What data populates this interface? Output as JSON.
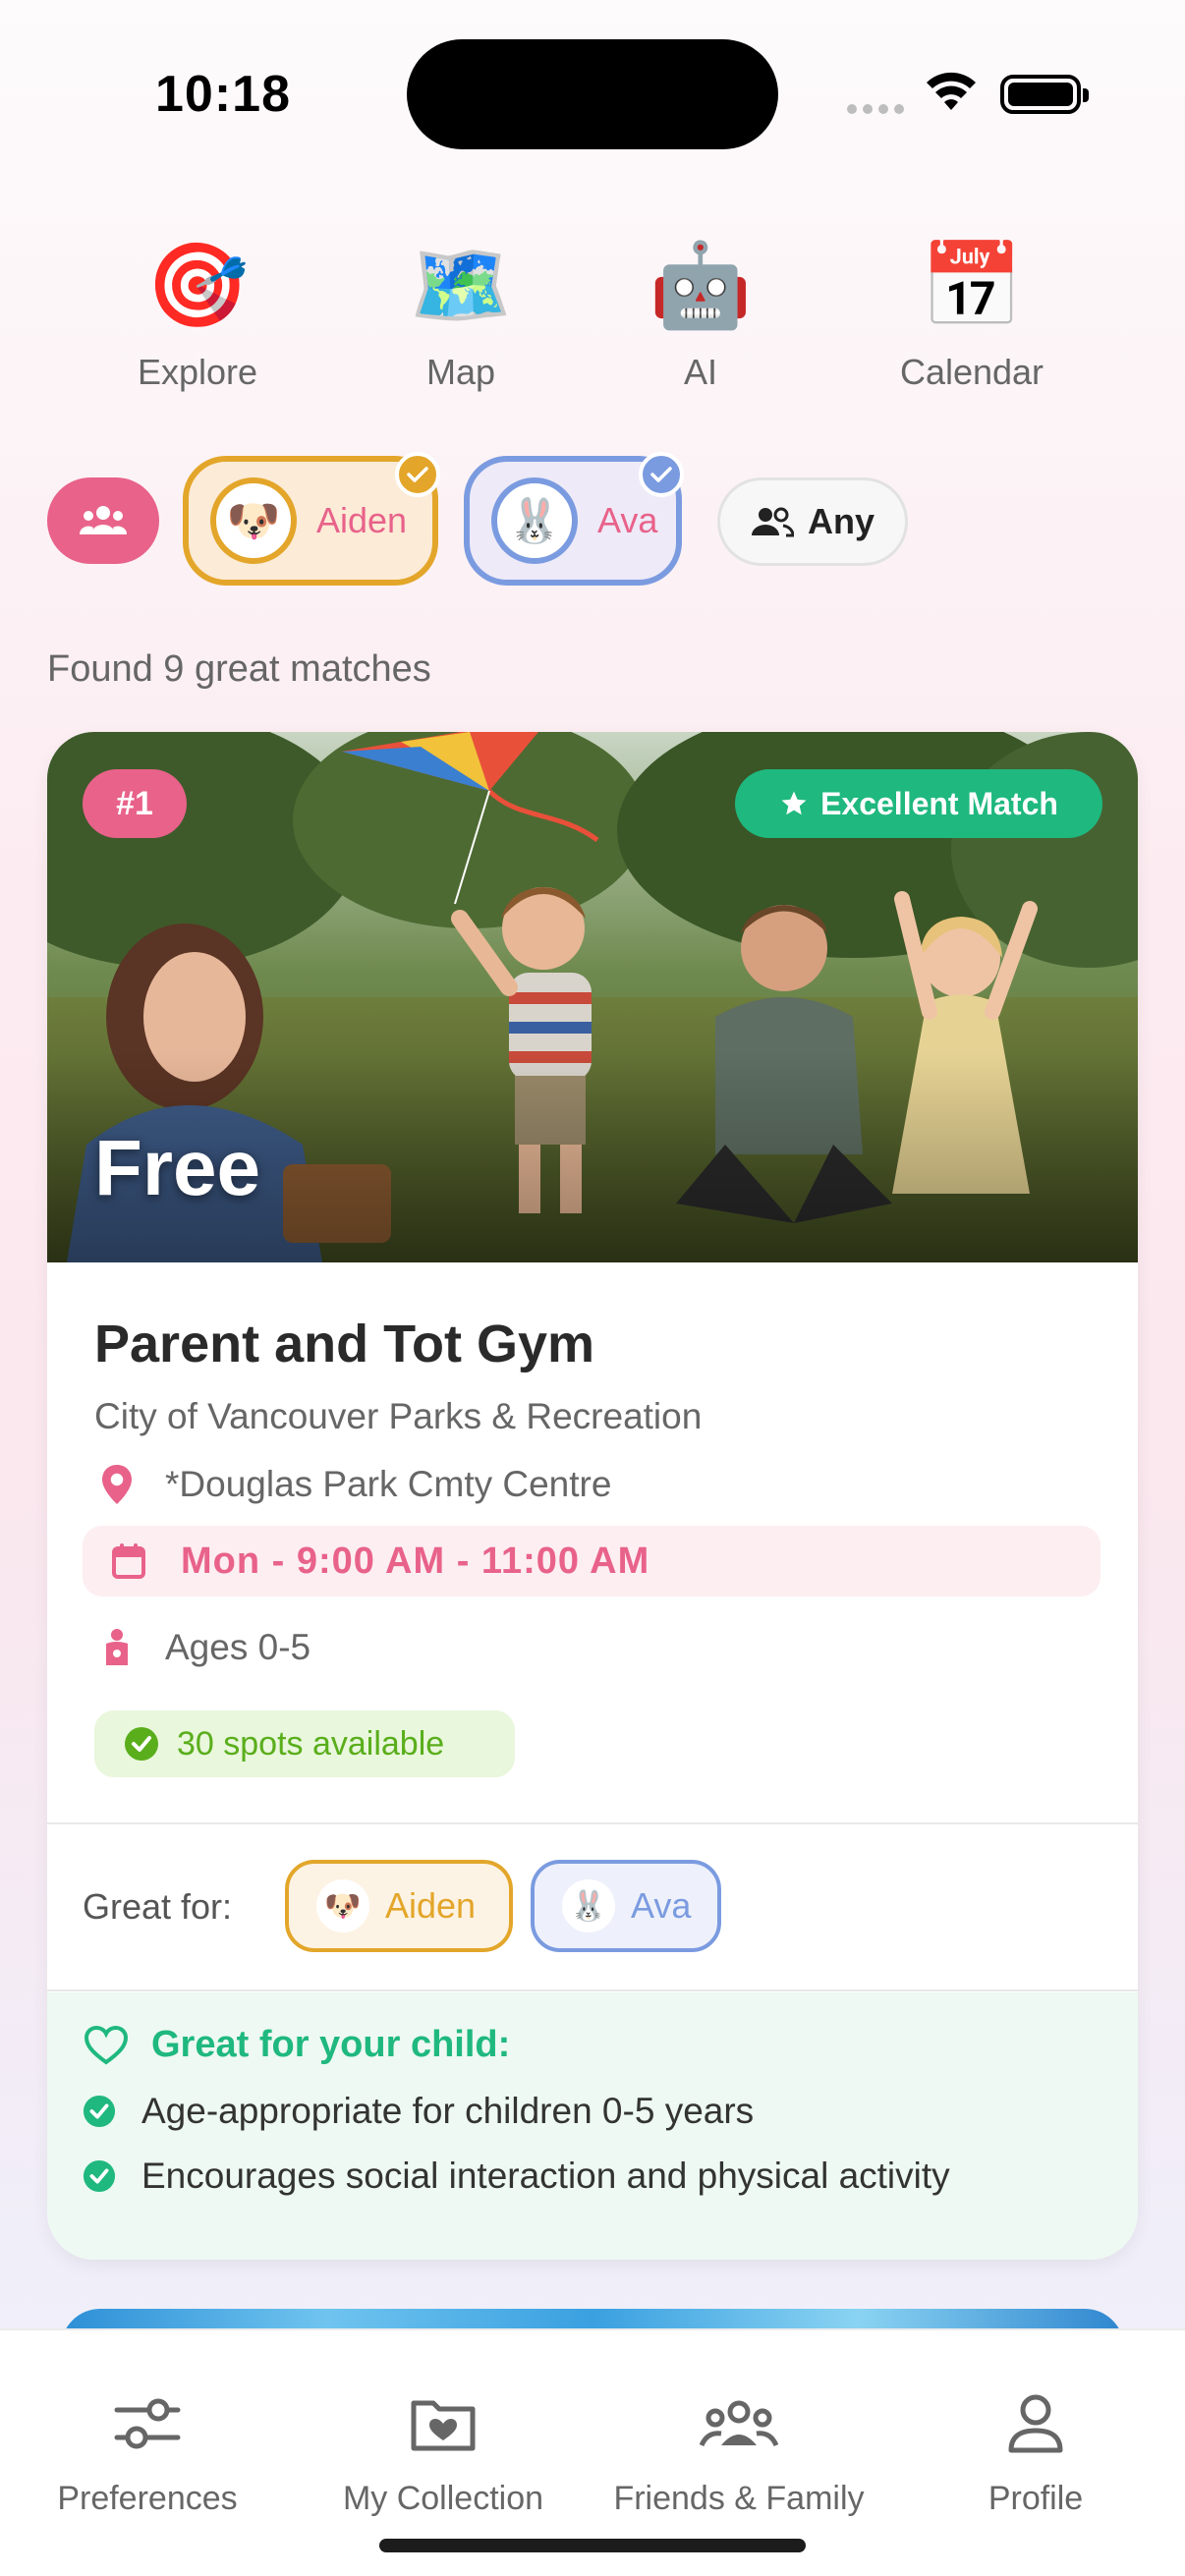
{
  "status_bar": {
    "time": "10:18"
  },
  "top_nav": [
    {
      "label": "Explore",
      "icon": "dart-target-icon",
      "emoji": "🎯"
    },
    {
      "label": "Map",
      "icon": "world-map-icon",
      "emoji": "🗺️"
    },
    {
      "label": "AI",
      "icon": "robot-icon",
      "emoji": "🤖"
    },
    {
      "label": "Calendar",
      "icon": "calendar-icon",
      "emoji": "📅"
    }
  ],
  "filters": {
    "children": [
      {
        "name": "Aiden",
        "avatar": "🐶",
        "selected": true,
        "color": "#e3a62a"
      },
      {
        "name": "Ava",
        "avatar": "🐰",
        "selected": true,
        "color": "#7b9be0"
      }
    ],
    "any_label": "Any"
  },
  "results": {
    "found_text": "Found 9 great matches"
  },
  "card": {
    "rank": "#1",
    "match_label": "Excellent Match",
    "price": "Free",
    "title": "Parent and Tot Gym",
    "provider": "City of Vancouver Parks & Recreation",
    "location": "*Douglas Park Cmty Centre",
    "schedule": "Mon - 9:00 AM - 11:00 AM",
    "ages": "Ages 0-5",
    "spots": "30 spots available",
    "great_for_label": "Great for:",
    "great_for": [
      {
        "name": "Aiden",
        "avatar": "🐶"
      },
      {
        "name": "Ava",
        "avatar": "🐰"
      }
    ],
    "benefits_title": "Great for your child:",
    "benefits": [
      "Age-appropriate for children 0-5 years",
      "Encourages social interaction and physical activity"
    ]
  },
  "tab_bar": [
    {
      "label": "Preferences",
      "icon": "sliders-icon"
    },
    {
      "label": "My Collection",
      "icon": "folder-heart-icon"
    },
    {
      "label": "Friends & Family",
      "icon": "people-group-icon"
    },
    {
      "label": "Profile",
      "icon": "person-icon"
    }
  ],
  "colors": {
    "accent": "#e8628a",
    "success": "#1fb87f",
    "aiden": "#e3a62a",
    "ava": "#7b9be0"
  }
}
